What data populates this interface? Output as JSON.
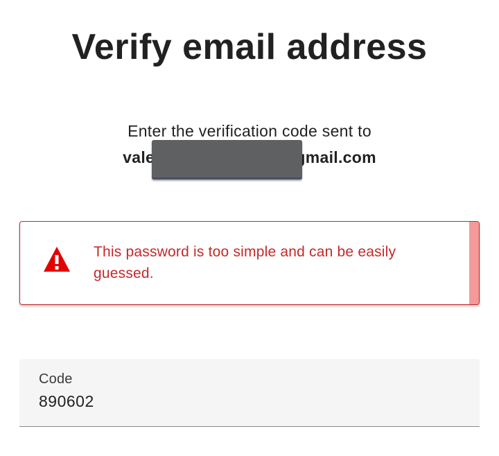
{
  "page": {
    "title": "Verify email address"
  },
  "instructions": {
    "text": "Enter the verification code sent to",
    "email_prefix": "valer",
    "email_suffix": "gmail.com"
  },
  "alert": {
    "icon": "warning-triangle-icon",
    "message": "This password is too simple and can be easily guessed.",
    "color": "#c62828",
    "stripe_color": "#f39a9a"
  },
  "code_field": {
    "label": "Code",
    "value": "890602"
  }
}
